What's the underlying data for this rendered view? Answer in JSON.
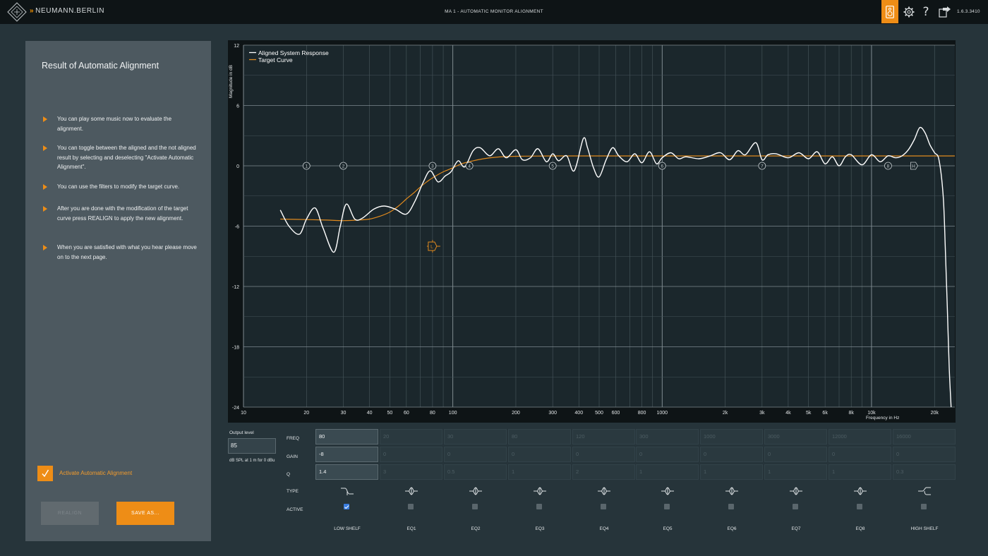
{
  "header": {
    "brand": "NEUMANN.BERLIN",
    "title": "MA 1 - AUTOMATIC MONITOR ALIGNMENT",
    "version": "1.6.3.3410",
    "help_glyph": "?",
    "icons": [
      "neumann-logo-icon",
      "speaker-icon",
      "gear-icon",
      "help-icon",
      "exit-icon"
    ],
    "accent_color": "#ee8d16"
  },
  "panel": {
    "title": "Result of Automatic Alignment",
    "instructions": [
      "You can play some music now to evaluate the alignment.",
      "You can toggle between the aligned and the not aligned result by selecting and deselecting \"Activate Automatic Alignment\".",
      "You can use the filters to modify the target curve.",
      "After you are done with the modification of the target curve press REALIGN to apply the new alignment.",
      "When you are satisfied with what you hear please move on to the next page."
    ],
    "activate_label": "Activate Automatic Alignment",
    "activate_checked": true,
    "realign_label": "REALIGN",
    "saveas_label": "SAVE AS..."
  },
  "chart_data": {
    "type": "line",
    "xscale": "log",
    "xlim": [
      10,
      25000
    ],
    "ylim": [
      -24,
      12
    ],
    "ylabel": "Magnitude in dB",
    "xlabel": "Frequency in Hz",
    "y_ticks": [
      "12",
      "6",
      "0",
      "-6",
      "-12",
      "-18",
      "-24"
    ],
    "x_ticks": [
      {
        "v": 10,
        "label": "10"
      },
      {
        "v": 20,
        "label": "20"
      },
      {
        "v": 30,
        "label": "30"
      },
      {
        "v": 40,
        "label": "40"
      },
      {
        "v": 50,
        "label": "50"
      },
      {
        "v": 60,
        "label": "60"
      },
      {
        "v": 80,
        "label": "80"
      },
      {
        "v": 100,
        "label": "100"
      },
      {
        "v": 200,
        "label": "200"
      },
      {
        "v": 300,
        "label": "300"
      },
      {
        "v": 400,
        "label": "400"
      },
      {
        "v": 500,
        "label": "500"
      },
      {
        "v": 600,
        "label": "600"
      },
      {
        "v": 800,
        "label": "800"
      },
      {
        "v": 1000,
        "label": "1000"
      },
      {
        "v": 2000,
        "label": "2k"
      },
      {
        "v": 3000,
        "label": "3k"
      },
      {
        "v": 4000,
        "label": "4k"
      },
      {
        "v": 5000,
        "label": "5k"
      },
      {
        "v": 6000,
        "label": "6k"
      },
      {
        "v": 8000,
        "label": "8k"
      },
      {
        "v": 10000,
        "label": "10k"
      },
      {
        "v": 20000,
        "label": "20k"
      }
    ],
    "grid": true,
    "legend": "top-left",
    "series": [
      {
        "name": "Aligned System Response",
        "color": "#ffffff",
        "x": [
          15,
          16.5,
          18.5,
          20,
          22,
          24,
          27,
          29,
          31,
          34,
          37,
          42,
          47,
          53,
          60,
          66,
          72,
          78,
          85,
          92,
          98,
          106,
          114,
          125,
          135,
          150,
          165,
          180,
          200,
          215,
          235,
          255,
          280,
          300,
          320,
          350,
          380,
          420,
          440,
          470,
          500,
          540,
          580,
          620,
          680,
          740,
          800,
          870,
          940,
          1000,
          1100,
          1200,
          1300,
          1500,
          1700,
          1900,
          2100,
          2300,
          2500,
          2800,
          3000,
          3200,
          3500,
          4000,
          4500,
          5000,
          5500,
          6000,
          6500,
          7000,
          7500,
          8000,
          9000,
          10000,
          11000,
          12000,
          13000,
          14000,
          15000,
          16000,
          17000,
          18000,
          19000,
          20000,
          21000,
          22000,
          22500,
          23000,
          23500,
          24000
        ],
        "y": [
          -4.4,
          -6.0,
          -6.8,
          -5.3,
          -4.2,
          -6.2,
          -8.6,
          -6.0,
          -3.8,
          -5.3,
          -5.2,
          -4.3,
          -4.0,
          -4.3,
          -4.8,
          -3.5,
          -1.7,
          -0.5,
          -1.6,
          -1.0,
          -0.6,
          0.5,
          -0.1,
          1.5,
          1.8,
          1.0,
          1.7,
          0.8,
          1.6,
          0.6,
          0.8,
          1.7,
          0.4,
          1.2,
          0.5,
          1.0,
          -0.5,
          2.7,
          1.8,
          -0.2,
          -1.1,
          0.6,
          1.8,
          1.0,
          0.4,
          1.2,
          0.3,
          1.4,
          0.2,
          0.8,
          1.3,
          0.7,
          0.9,
          0.7,
          1.0,
          1.3,
          0.6,
          1.5,
          1.1,
          2.3,
          0.6,
          1.1,
          1.2,
          0.8,
          1.3,
          0.7,
          1.4,
          0.2,
          0.9,
          0.0,
          0.9,
          1.1,
          0.1,
          1.1,
          0.4,
          1.0,
          0.8,
          1.0,
          1.6,
          2.6,
          3.8,
          3.3,
          2.1,
          1.3,
          0.6,
          -3.0,
          -8.0,
          -14.0,
          -20.0,
          -24.0
        ]
      },
      {
        "name": "Target Curve",
        "color": "#e08a1e",
        "x": [
          15,
          20,
          25,
          30,
          35,
          40,
          45,
          50,
          55,
          60,
          65,
          70,
          75,
          80,
          90,
          100,
          110,
          125,
          140,
          160,
          180,
          200,
          250,
          300,
          400,
          600,
          1000,
          2000,
          5000,
          10000,
          15000,
          20000,
          25000
        ],
        "y": [
          -5.3,
          -5.35,
          -5.4,
          -5.45,
          -5.4,
          -5.3,
          -5.0,
          -4.6,
          -4.0,
          -3.3,
          -2.7,
          -2.1,
          -1.6,
          -1.2,
          -0.6,
          -0.2,
          0.2,
          0.5,
          0.7,
          0.85,
          0.92,
          0.95,
          0.97,
          0.98,
          0.98,
          0.98,
          0.98,
          0.98,
          0.98,
          0.98,
          0.98,
          0.98,
          0.98
        ]
      }
    ],
    "markers": [
      {
        "label": "1",
        "x": 20,
        "y": 0,
        "active": false
      },
      {
        "label": "2",
        "x": 30,
        "y": 0,
        "active": false
      },
      {
        "label": "3",
        "x": 80,
        "y": 0,
        "active": false
      },
      {
        "label": "4",
        "x": 120,
        "y": 0,
        "active": false
      },
      {
        "label": "5",
        "x": 300,
        "y": 0,
        "active": false
      },
      {
        "label": "6",
        "x": 1000,
        "y": 0,
        "active": false
      },
      {
        "label": "7",
        "x": 3000,
        "y": 0,
        "active": false
      },
      {
        "label": "8",
        "x": 12000,
        "y": 0,
        "active": false
      },
      {
        "label": "H",
        "x": 16000,
        "y": 0,
        "active": false
      },
      {
        "label": "L",
        "x": 80,
        "y": -8,
        "active": true
      }
    ]
  },
  "filters": {
    "output_level_label": "Output level",
    "output_level_value": "85",
    "output_unit": "dB SPL at 1 m for 0 dBu",
    "row_labels": {
      "freq": "FREQ",
      "gain": "GAIN",
      "q": "Q",
      "type": "TYPE",
      "active": "ACTIVE"
    },
    "bands": [
      {
        "name": "LOW SHELF",
        "freq": "80",
        "gain": "-8",
        "q": "1.4",
        "type": "low-shelf",
        "active": true
      },
      {
        "name": "EQ1",
        "freq": "20",
        "gain": "0",
        "q": "3",
        "type": "peak",
        "active": false
      },
      {
        "name": "EQ2",
        "freq": "30",
        "gain": "0",
        "q": "0.5",
        "type": "peak",
        "active": false
      },
      {
        "name": "EQ3",
        "freq": "80",
        "gain": "0",
        "q": "1",
        "type": "peak",
        "active": false
      },
      {
        "name": "EQ4",
        "freq": "120",
        "gain": "0",
        "q": "2",
        "type": "peak",
        "active": false
      },
      {
        "name": "EQ5",
        "freq": "300",
        "gain": "0",
        "q": "1",
        "type": "peak",
        "active": false
      },
      {
        "name": "EQ6",
        "freq": "1000",
        "gain": "0",
        "q": "1",
        "type": "peak",
        "active": false
      },
      {
        "name": "EQ7",
        "freq": "3000",
        "gain": "0",
        "q": "1",
        "type": "peak",
        "active": false
      },
      {
        "name": "EQ8",
        "freq": "12000",
        "gain": "0",
        "q": "1",
        "type": "peak",
        "active": false
      },
      {
        "name": "HIGH SHELF",
        "freq": "16000",
        "gain": "0",
        "q": "0.3",
        "type": "high-shelf",
        "active": false
      }
    ]
  }
}
